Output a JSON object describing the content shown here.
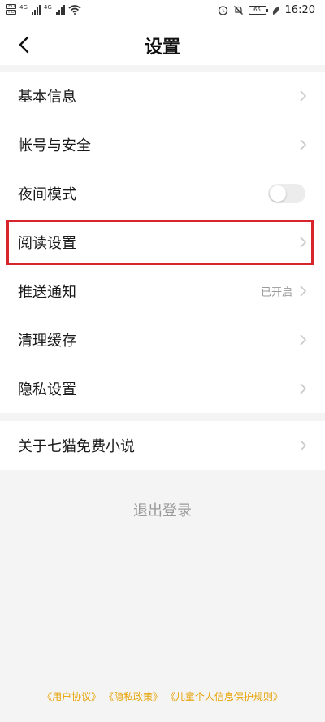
{
  "status_bar": {
    "sim1": "HD",
    "sim2": "HD",
    "signal1_label": "4G",
    "signal2_label": "4G",
    "battery": "65",
    "time": "16:20"
  },
  "header": {
    "title": "设置",
    "back_icon": "chevron-left-icon"
  },
  "settings": {
    "group1": [
      {
        "label": "基本信息"
      },
      {
        "label": "帐号与安全"
      },
      {
        "label": "夜间模式",
        "toggle_on": false
      },
      {
        "label": "阅读设置",
        "highlighted": true
      },
      {
        "label": "推送通知",
        "value": "已开启"
      },
      {
        "label": "清理缓存"
      },
      {
        "label": "隐私设置"
      }
    ],
    "group2": [
      {
        "label": "关于七猫免费小说"
      }
    ]
  },
  "logout_label": "退出登录",
  "footer": {
    "links": [
      "《用户协议》",
      "《隐私政策》",
      "《儿童个人信息保护规则》"
    ]
  },
  "colors": {
    "highlight_border": "#d8242b",
    "footer_link": "#e6a200",
    "background": "#f4f4f5"
  }
}
